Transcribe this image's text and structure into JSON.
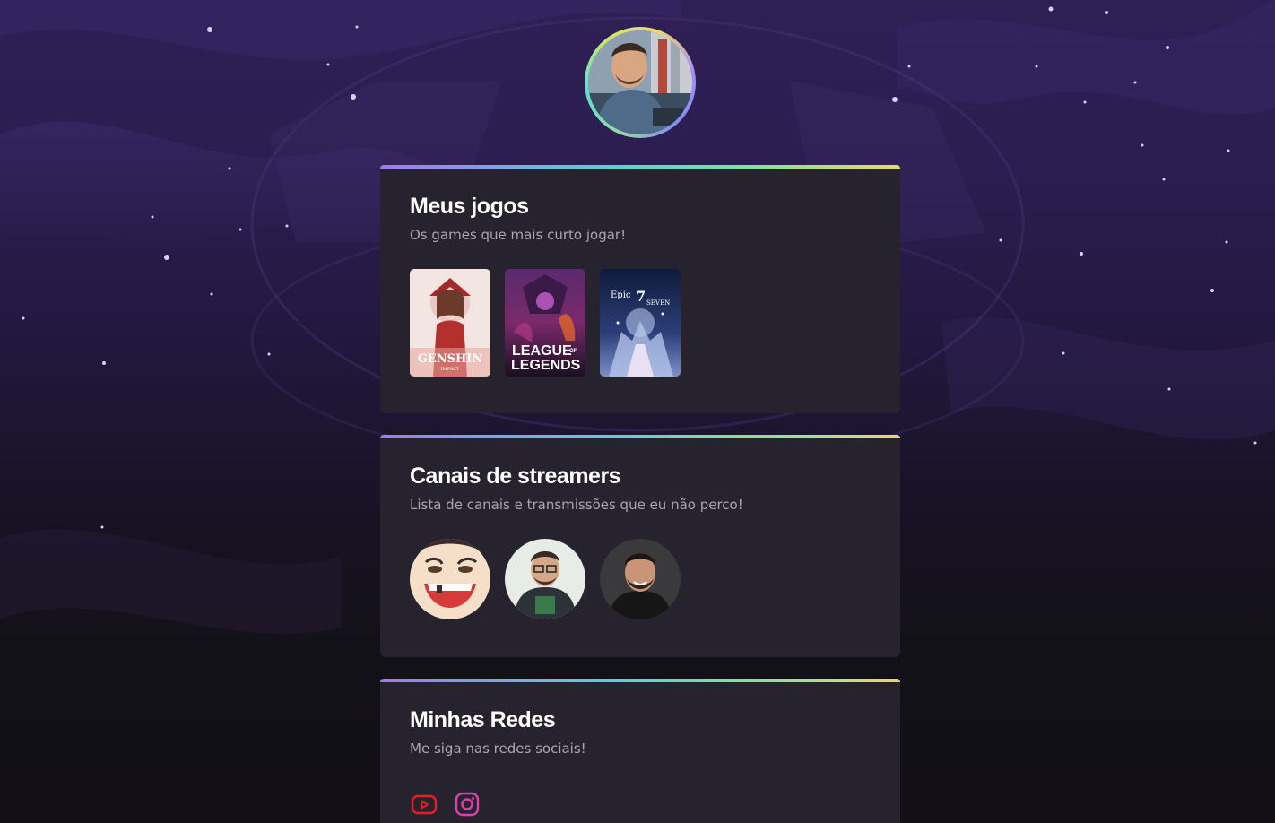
{
  "profile": {
    "avatar_icon": "profile-photo"
  },
  "games": {
    "title": "Meus jogos",
    "subtitle": "Os games que mais curto jogar!",
    "items": [
      {
        "name": "Genshin Impact",
        "logo_line1": "GENSHIN",
        "logo_line2": "IMPACT"
      },
      {
        "name": "League of Legends",
        "logo_line1": "LEAGUE",
        "logo_of": "OF",
        "logo_line2": "LEGENDS"
      },
      {
        "name": "Epic Seven",
        "logo_line1": "Epic",
        "logo_num": "7",
        "logo_line2": "SEVEN"
      }
    ]
  },
  "streamers": {
    "title": "Canais de streamers",
    "subtitle": "Lista de canais e transmissões que eu não perco!"
  },
  "social": {
    "title": "Minhas Redes",
    "subtitle": "Me siga nas redes sociais!",
    "links": [
      {
        "icon": "youtube-icon",
        "color": "#e41e25"
      },
      {
        "icon": "instagram-icon",
        "color": "#e23fae"
      }
    ]
  },
  "colors": {
    "card_bg": "#26232f",
    "accent_gradient": [
      "#9f7aea",
      "#5ccfd6",
      "#7ee2a0",
      "#e8d86a"
    ]
  }
}
